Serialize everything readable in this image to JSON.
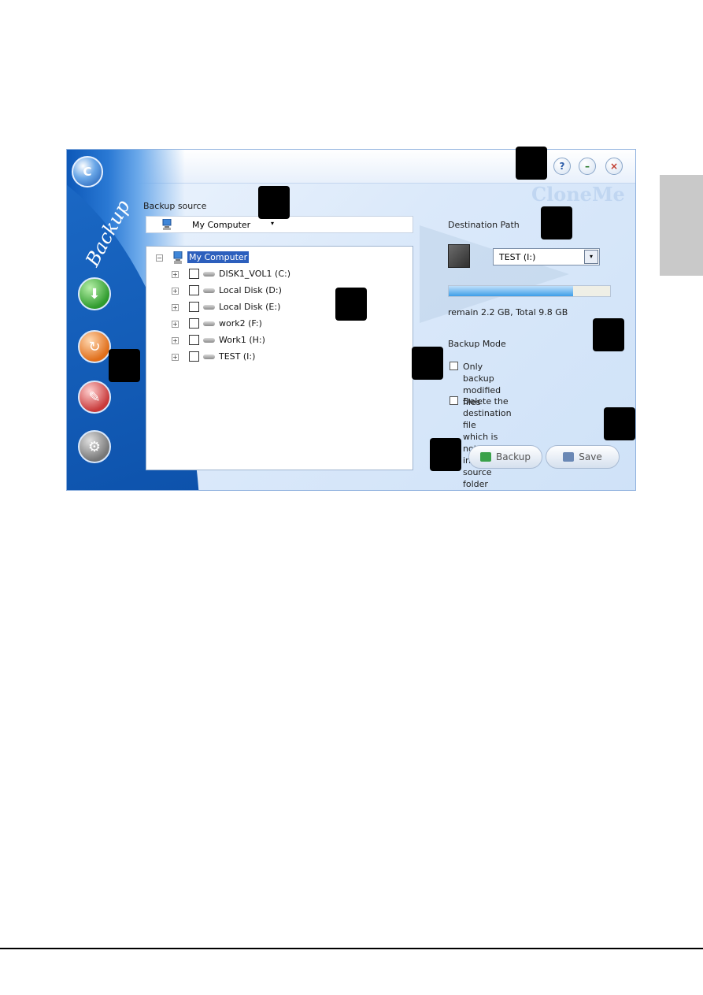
{
  "window": {
    "sidebar_title": "Backup",
    "watermark": "CloneMe",
    "help_glyph": "?",
    "minimize_glyph": "–",
    "close_glyph": "×"
  },
  "icons": [
    "logo-icon",
    "backup-nav-icon",
    "restore-nav-icon",
    "schedule-nav-icon",
    "tools-nav-icon",
    "computer-icon",
    "drive-icon",
    "destination-drive-icon",
    "backup-icon",
    "save-icon"
  ],
  "source": {
    "label": "Backup source",
    "selected": "My Computer",
    "caret": "▾"
  },
  "tree": {
    "root": "My Computer",
    "root_expander": "−",
    "item_expander": "+",
    "items": [
      "DISK1_VOL1 (C:)",
      "Local Disk (D:)",
      "Local Disk (E:)",
      "work2 (F:)",
      "Work1 (H:)",
      "TEST (I:)"
    ]
  },
  "destination": {
    "label": "Destination Path",
    "selected": "TEST (I:)",
    "caret": "▾",
    "usage_fraction": 0.77,
    "capacity_text": "remain 2.2 GB, Total 9.8 GB"
  },
  "backup_mode": {
    "label": "Backup Mode",
    "only_modified": "Only backup modified files",
    "delete_dest_line1": "Delete the destination file",
    "delete_dest_line2": "which is not existed in the",
    "delete_dest_line3": "source folder"
  },
  "buttons": {
    "backup": "Backup",
    "save": "Save"
  },
  "colors": {
    "sidebar_blue": "#0d58b8",
    "selection_blue": "#2c5fbd",
    "callout_marker": "#000000",
    "page_tab_gray": "#c9c9c9"
  }
}
